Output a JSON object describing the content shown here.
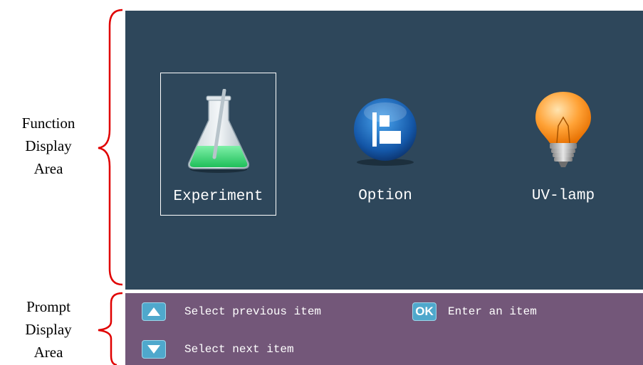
{
  "side_labels": {
    "function_area": [
      "Function",
      "Display",
      "Area"
    ],
    "prompt_area": [
      "Prompt",
      "Display",
      "Area"
    ]
  },
  "function_items": [
    {
      "label": "Experiment",
      "icon": "flask-icon",
      "selected": true
    },
    {
      "label": "Option",
      "icon": "option-icon",
      "selected": false
    },
    {
      "label": "UV-lamp",
      "icon": "bulb-icon",
      "selected": false
    }
  ],
  "prompts": {
    "previous": {
      "key": "up-arrow-key",
      "text": "Select previous item"
    },
    "enter": {
      "key": "OK",
      "text": "Enter an item"
    },
    "next": {
      "key": "down-arrow-key",
      "text": "Select next item"
    }
  },
  "colors": {
    "function_bg": "#2e475b",
    "prompt_bg": "#735779",
    "brace": "#e00000",
    "key": "#4fa8cc"
  }
}
